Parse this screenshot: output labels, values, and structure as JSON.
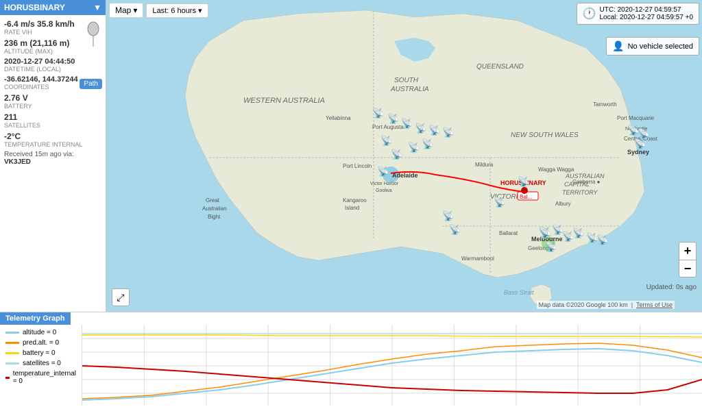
{
  "leftPanel": {
    "title": "HORUSBINARY",
    "speed": "-6.4 m/s 35.8 km/h",
    "speedLabel": "RATE VIH",
    "altitude": "236 m (21,116 m)",
    "altitudeLabel": "ALTITUDE (MAX)",
    "datetime": "2020-12-27 04:44:50",
    "datetimeLabel": "DATETIME (LOCAL)",
    "coordinates": "-36.62146, 144.37244",
    "coordinatesLabel": "COORDINATES",
    "battery": "2.76 V",
    "batteryLabel": "BATTERY",
    "satellites": "211",
    "satellitesLabel": "SATELLITES",
    "temperature": "-2°C",
    "temperatureLabel": "TEMPERATURE INTERNAL",
    "received": "Received 15m ago via:",
    "callsign": "VK3JED",
    "pathBtn": "Path"
  },
  "mapToolbar": {
    "mapLabel": "Map",
    "timeLabel": "Last: 6 hours"
  },
  "utcPanel": {
    "utcTime": "UTC: 2020-12-27 04:59:57",
    "localTime": "Local: 2020-12-27 04:59:57 +0"
  },
  "vehicleSelector": {
    "label": "No vehicle selected"
  },
  "mapAttribution": {
    "text": "Map data ©2020 Google  100 km",
    "terms": "Terms of Use"
  },
  "updatedLabel": "Updated: 0s ago",
  "zoomControls": {
    "in": "+",
    "out": "−"
  },
  "telemetry": {
    "header": "Telemetry Graph",
    "legend": [
      {
        "label": "altitude = 0",
        "color": "#87ceeb"
      },
      {
        "label": "pred.alt. = 0",
        "color": "#ff8c00"
      },
      {
        "label": "battery = 0",
        "color": "#ffd700"
      },
      {
        "label": "satellites = 0",
        "color": "#add8e6"
      },
      {
        "label": "temperature_internal = 0",
        "color": "#cc0000"
      }
    ]
  }
}
